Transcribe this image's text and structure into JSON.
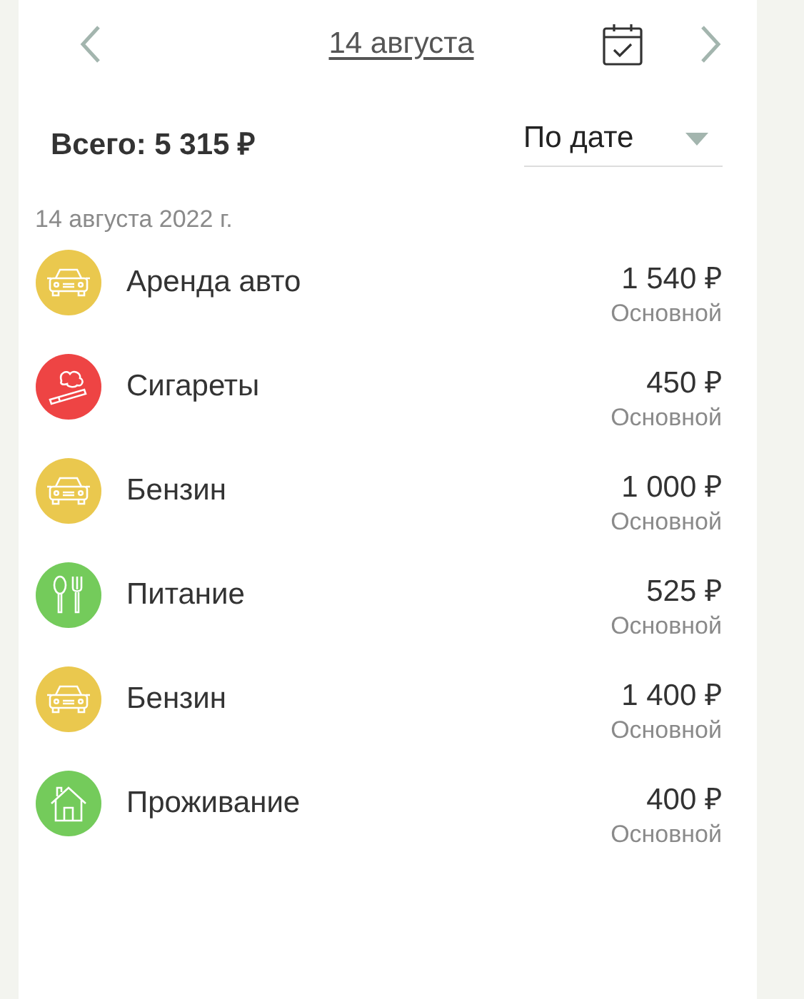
{
  "header": {
    "date": "14 августа"
  },
  "summary": {
    "total": "Всего: 5 315 ₽",
    "sort": "По дате"
  },
  "group": {
    "date": "14 августа 2022 г.",
    "items": [
      {
        "kind": "car",
        "color": "#eac84e",
        "name": "Аренда авто",
        "amount": "1 540 ₽",
        "account": "Основной"
      },
      {
        "kind": "smoke",
        "color": "#ee4444",
        "name": "Сигареты",
        "amount": "450 ₽",
        "account": "Основной"
      },
      {
        "kind": "car",
        "color": "#eac84e",
        "name": "Бензин",
        "amount": "1 000 ₽",
        "account": "Основной"
      },
      {
        "kind": "food",
        "color": "#74cb5b",
        "name": "Питание",
        "amount": "525 ₽",
        "account": "Основной"
      },
      {
        "kind": "car",
        "color": "#eac84e",
        "name": "Бензин",
        "amount": "1 400 ₽",
        "account": "Основной"
      },
      {
        "kind": "house",
        "color": "#74cb5b",
        "name": "Проживание",
        "amount": "400 ₽",
        "account": "Основной"
      }
    ]
  }
}
